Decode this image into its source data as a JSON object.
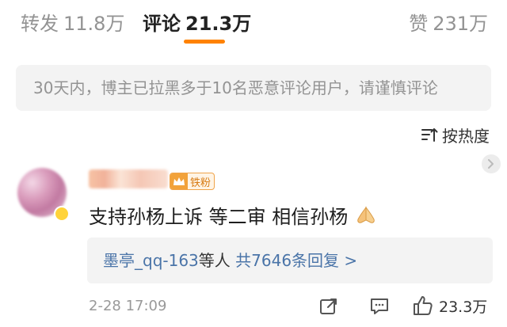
{
  "tabs": {
    "repost": {
      "label": "转发",
      "count": "11.8万"
    },
    "comment": {
      "label": "评论",
      "count": "21.3万"
    },
    "like": {
      "label": "赞",
      "count": "231万"
    }
  },
  "notice": "30天内，博主已拉黑多于10名恶意评论用户，请谨慎评论",
  "sort": {
    "label": "按热度",
    "icon": "sort-icon"
  },
  "comment": {
    "fan_badge": "铁粉",
    "text": "支持孙杨上诉 等二审 相信孙杨",
    "emoji": "praying-hands",
    "replies": {
      "user": "墨亭_qq-163",
      "mid": "等人",
      "count_text": "共7646条回复 >"
    },
    "time": "2-28 17:09",
    "like_count": "23.3万"
  },
  "colors": {
    "accent": "#ff8200",
    "link": "#4a74a8",
    "muted": "#939393",
    "panel": "#f3f3f3"
  }
}
